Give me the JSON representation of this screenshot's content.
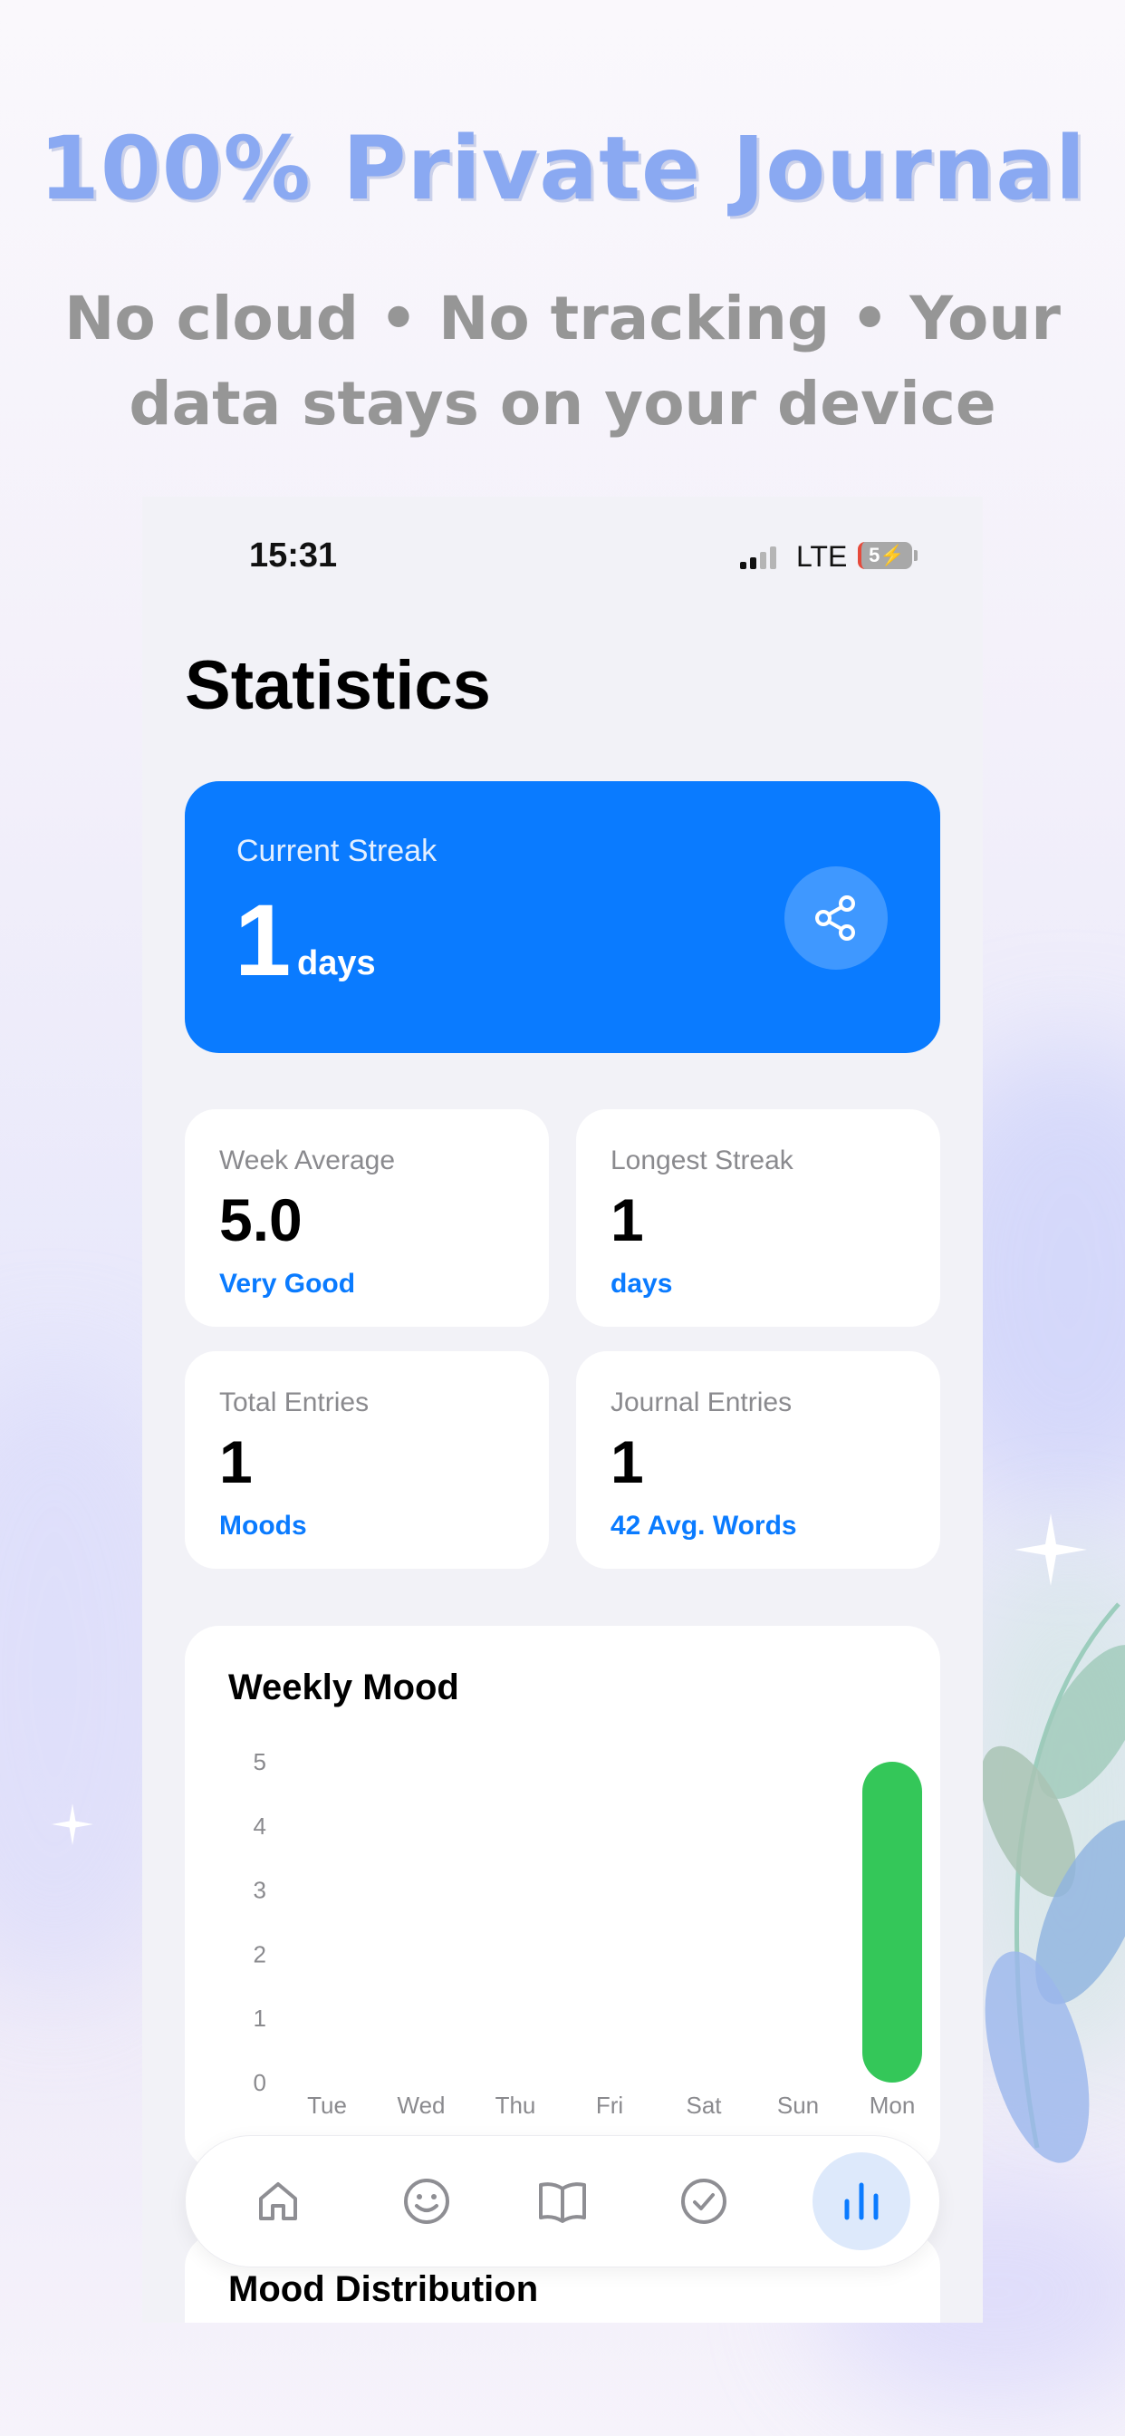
{
  "promo": {
    "headline": "100% Private Journal",
    "subhead": "No cloud • No tracking • Your data stays on your device"
  },
  "status_bar": {
    "time": "15:31",
    "network": "LTE",
    "battery": "5"
  },
  "page": {
    "title": "Statistics"
  },
  "streak": {
    "label": "Current Streak",
    "value": "1",
    "unit": "days",
    "share_icon": "share-icon"
  },
  "stats": [
    {
      "label": "Week Average",
      "value": "5.0",
      "sub": "Very Good"
    },
    {
      "label": "Longest Streak",
      "value": "1",
      "sub": "days"
    },
    {
      "label": "Total Entries",
      "value": "1",
      "sub": "Moods"
    },
    {
      "label": "Journal Entries",
      "value": "1",
      "sub": "42 Avg. Words"
    }
  ],
  "chart_data": {
    "type": "bar",
    "title": "Weekly Mood",
    "categories": [
      "Tue",
      "Wed",
      "Thu",
      "Fri",
      "Sat",
      "Sun",
      "Mon"
    ],
    "values": [
      0,
      0,
      0,
      0,
      0,
      0,
      5
    ],
    "yticks": [
      "0",
      "1",
      "2",
      "3",
      "4",
      "5"
    ],
    "ylim": [
      0,
      5
    ],
    "bar_color": "#34c759",
    "grid": false
  },
  "distribution": {
    "title": "Mood Distribution"
  },
  "tabbar": {
    "items": [
      {
        "icon": "home-icon",
        "active": false
      },
      {
        "icon": "smiley-icon",
        "active": false
      },
      {
        "icon": "book-icon",
        "active": false
      },
      {
        "icon": "checkmark-circle-icon",
        "active": false
      },
      {
        "icon": "bar-chart-icon",
        "active": true
      }
    ]
  },
  "colors": {
    "accent": "#0a7bff",
    "bar": "#34c759",
    "headline": "#8aa9f2"
  }
}
